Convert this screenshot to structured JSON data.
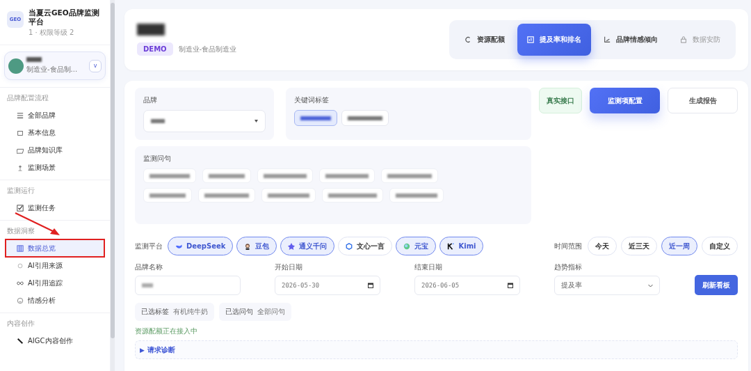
{
  "sidebar": {
    "logo": "GEO",
    "title": "当夏云GEO品牌监测平台",
    "subtitle": "1 · 权限等级 2",
    "brand_card": {
      "industry": "制造业-食品制...",
      "caret": "v"
    },
    "sections": [
      {
        "label": "品牌配置流程",
        "items": [
          {
            "label": "全部品牌",
            "selected": false
          },
          {
            "label": "基本信息",
            "selected": false
          },
          {
            "label": "品牌知识库",
            "selected": false
          },
          {
            "label": "监测场景",
            "selected": false
          }
        ]
      },
      {
        "label": "监测运行",
        "items": [
          {
            "label": "监测任务",
            "selected": false
          }
        ]
      },
      {
        "label": "数据洞察",
        "items": [
          {
            "label": "数据总览",
            "selected": true
          },
          {
            "label": "AI引用来源",
            "selected": false
          },
          {
            "label": "AI引用追踪",
            "selected": false
          },
          {
            "label": "情感分析",
            "selected": false
          }
        ]
      },
      {
        "label": "内容创作",
        "items": [
          {
            "label": "AIGC内容创作",
            "selected": false
          }
        ]
      }
    ]
  },
  "header": {
    "badge": "DEMO",
    "industry": "制造业-食品制造业",
    "tabs": [
      {
        "label": "资源配额",
        "selected": false,
        "disabled": false
      },
      {
        "label": "提及率和排名",
        "selected": true,
        "disabled": false
      },
      {
        "label": "品牌情感倾向",
        "selected": false,
        "disabled": false
      },
      {
        "label": "数据安防",
        "selected": false,
        "disabled": true
      }
    ]
  },
  "config": {
    "brand_label": "品牌",
    "keyword_label": "关键词标签",
    "keyword_tags": [
      {
        "selected": true
      },
      {
        "selected": false
      }
    ],
    "question_label": "监测问句",
    "buttons": [
      {
        "kind": "status",
        "label": "真实接口"
      },
      {
        "kind": "primary",
        "label": "监测项配置"
      },
      {
        "kind": "plain",
        "label": "生成报告"
      }
    ]
  },
  "platforms": {
    "label": "监测平台",
    "items": [
      {
        "label": "DeepSeek",
        "selected": true
      },
      {
        "label": "豆包",
        "selected": true
      },
      {
        "label": "通义千问",
        "selected": true
      },
      {
        "label": "文心一言",
        "selected": false
      },
      {
        "label": "元宝",
        "selected": true
      },
      {
        "label": "Kimi",
        "selected": true
      }
    ]
  },
  "time_range": {
    "label": "时间范围",
    "options": [
      {
        "label": "今天",
        "selected": false
      },
      {
        "label": "近三天",
        "selected": false
      },
      {
        "label": "近一周",
        "selected": true
      },
      {
        "label": "自定义",
        "selected": false
      }
    ]
  },
  "filters": {
    "brand_name_label": "品牌名称",
    "start_label": "开始日期",
    "start_value": "2026-05-30",
    "end_label": "结束日期",
    "end_value": "2026-06-05",
    "metric_label": "趋势指标",
    "metric_value": "提及率",
    "refresh_button": "刷新看板"
  },
  "selections": [
    {
      "label": "已选标签",
      "value": "有机纯牛奶"
    },
    {
      "label": "已选问句",
      "value": "全部问句"
    }
  ],
  "status_text": "资源配额正在接入中",
  "diagnostics": {
    "marker": "▶",
    "label": "请求诊断",
    "expanded": false
  }
}
